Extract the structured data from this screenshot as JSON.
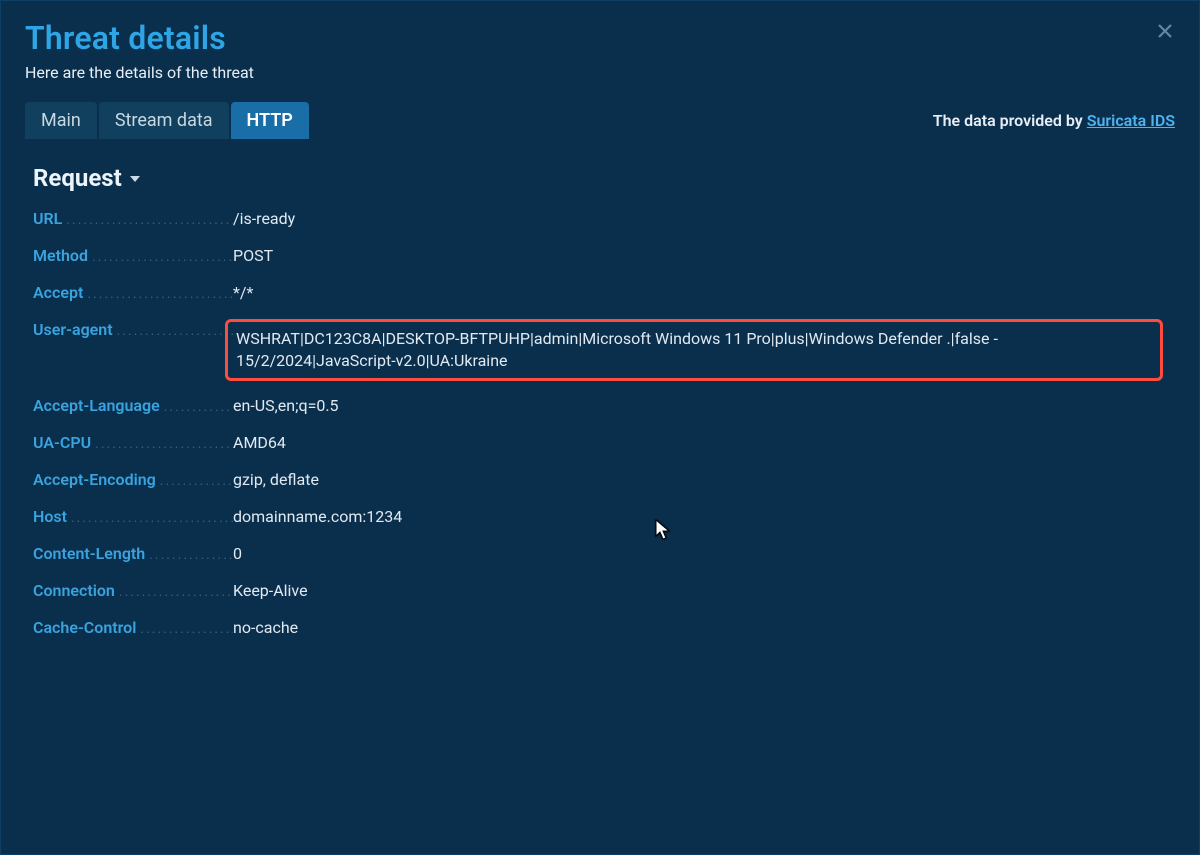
{
  "header": {
    "title": "Threat details",
    "subtitle": "Here are the details of the threat"
  },
  "provider": {
    "prefix": "The data provided by ",
    "link": "Suricata IDS"
  },
  "tabs": [
    {
      "label": "Main",
      "active": false
    },
    {
      "label": "Stream data",
      "active": false
    },
    {
      "label": "HTTP",
      "active": true
    }
  ],
  "section": {
    "title": "Request"
  },
  "request": {
    "rows": [
      {
        "key": "URL",
        "value": "/is-ready",
        "highlight": false
      },
      {
        "key": "Method",
        "value": "POST",
        "highlight": false
      },
      {
        "key": "Accept",
        "value": "*/*",
        "highlight": false
      },
      {
        "key": "User-agent",
        "value": "WSHRAT|DC123C8A|DESKTOP-BFTPUHP|admin|Microsoft Windows 11 Pro|plus|Windows Defender .|false - 15/2/2024|JavaScript-v2.0|UA:Ukraine",
        "highlight": true
      },
      {
        "key": "Accept-Language",
        "value": "en-US,en;q=0.5",
        "highlight": false
      },
      {
        "key": "UA-CPU",
        "value": "AMD64",
        "highlight": false
      },
      {
        "key": "Accept-Encoding",
        "value": "gzip, deflate",
        "highlight": false
      },
      {
        "key": "Host",
        "value": "domainname.com:1234",
        "highlight": false
      },
      {
        "key": "Content-Length",
        "value": "0",
        "highlight": false
      },
      {
        "key": "Connection",
        "value": "Keep-Alive",
        "highlight": false
      },
      {
        "key": "Cache-Control",
        "value": "no-cache",
        "highlight": false
      }
    ]
  },
  "colors": {
    "accent": "#2ea6e6",
    "highlight_border": "#ff4c3f",
    "bg": "#0a2f4d"
  }
}
